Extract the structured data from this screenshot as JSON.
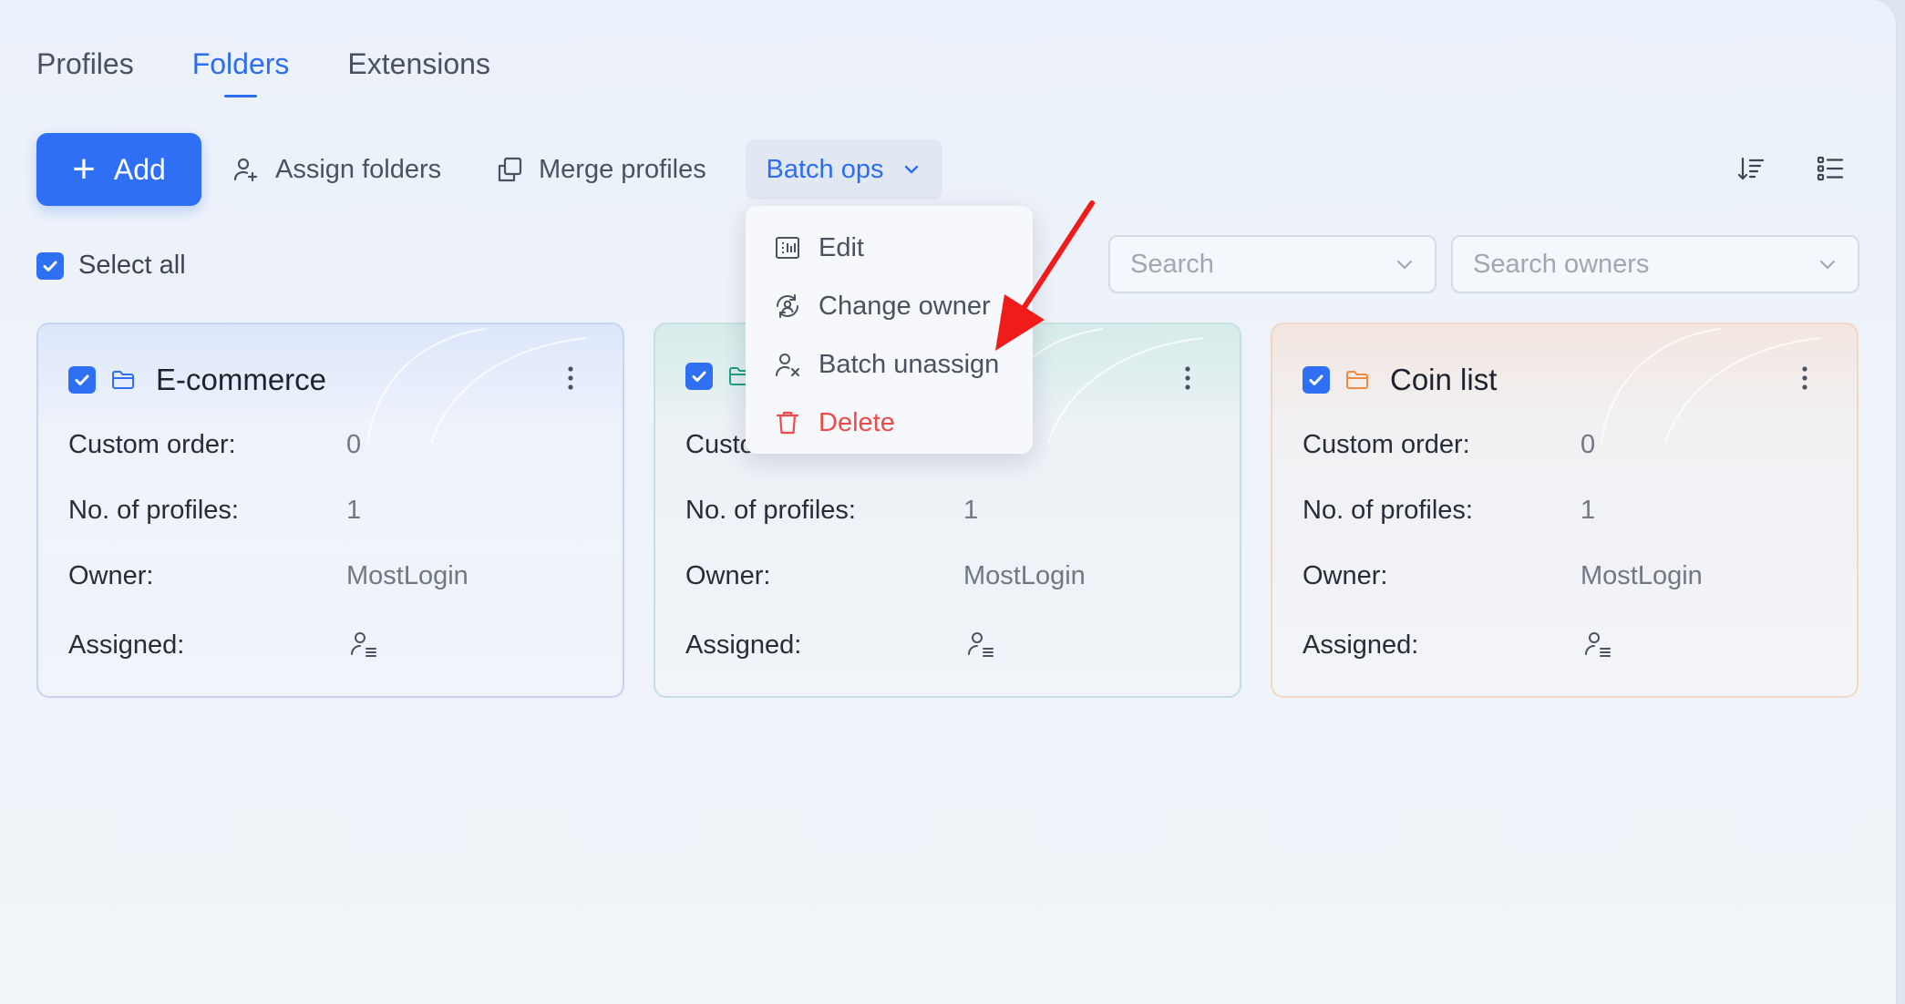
{
  "tabs": [
    {
      "label": "Profiles",
      "active": false
    },
    {
      "label": "Folders",
      "active": true
    },
    {
      "label": "Extensions",
      "active": false
    }
  ],
  "toolbar": {
    "add_label": "Add",
    "assign_folders_label": "Assign folders",
    "merge_profiles_label": "Merge profiles",
    "batch_ops_label": "Batch ops"
  },
  "select_all_label": "Select all",
  "search": {
    "placeholder": "Search",
    "owners_placeholder": "Search owners"
  },
  "batch_menu": {
    "items": [
      {
        "label": "Edit",
        "icon": "edit-icon"
      },
      {
        "label": "Change owner",
        "icon": "change-owner-icon"
      },
      {
        "label": "Batch unassign",
        "icon": "unassign-icon"
      },
      {
        "label": "Delete",
        "icon": "trash-icon",
        "color": "#ef4a4a"
      }
    ]
  },
  "field_labels": {
    "custom_order": "Custom order:",
    "profiles": "No. of profiles:",
    "owner": "Owner:",
    "assigned": "Assigned:"
  },
  "folders": [
    {
      "name": "E-commerce",
      "custom_order": "0",
      "profiles": "1",
      "owner": "MostLogin",
      "accent": "#2f6ff3"
    },
    {
      "name": "",
      "custom_order": "",
      "profiles": "1",
      "owner": "MostLogin",
      "accent": "#1ba37c"
    },
    {
      "name": "Coin list",
      "custom_order": "0",
      "profiles": "1",
      "owner": "MostLogin",
      "accent": "#f08a3e"
    }
  ],
  "colors": {
    "accent": "#2f6ff3",
    "danger": "#ef4a4a",
    "annotation_arrow": "#f01c1c"
  }
}
